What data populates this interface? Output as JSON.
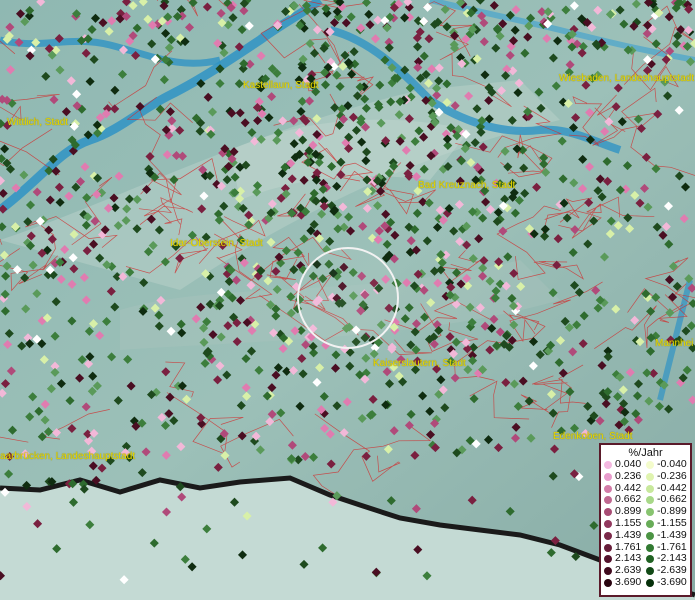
{
  "map": {
    "places": [
      {
        "id": "kastellaun",
        "label": "Kastellaun, Stadt"
      },
      {
        "id": "wiesbaden",
        "label": "Wiesbaden, Landeshauptstadt"
      },
      {
        "id": "wittlich",
        "label": "Wittlich, Stadt"
      },
      {
        "id": "bad-kreuznach",
        "label": "Bad Kreuznach, Stadt"
      },
      {
        "id": "idar-oberstein",
        "label": "Idar-Oberstein, Stadt"
      },
      {
        "id": "kaiserslautern",
        "label": "Kaiserslautern, Stadt"
      },
      {
        "id": "mannheim",
        "label": "Mannhei"
      },
      {
        "id": "edenkoben",
        "label": "Edenkoben, Stadt"
      },
      {
        "id": "saarbruecken",
        "label": "aarbrücken, Landeshauptstadt"
      }
    ]
  },
  "legend": {
    "title": "%/Jahr",
    "positive": [
      "0.040",
      "0.236",
      "0.442",
      "0.662",
      "0.899",
      "1.155",
      "1.439",
      "1.761",
      "2.143",
      "2.639",
      "3.690"
    ],
    "negative": [
      "-0.040",
      "-0.236",
      "-0.442",
      "-0.662",
      "-0.899",
      "-1.155",
      "-1.439",
      "-1.761",
      "-2.143",
      "-2.639",
      "-3.690"
    ],
    "positive_colors": [
      "#f4b8e0",
      "#e89ccc",
      "#d47ca8",
      "#c06890",
      "#a84c74",
      "#92385e",
      "#7c2a4a",
      "#681e3a",
      "#54122c",
      "#400a1e",
      "#2a0410"
    ],
    "negative_colors": [
      "#f4fccc",
      "#e0f4b0",
      "#c8e89c",
      "#a8d888",
      "#88c470",
      "#68ac58",
      "#4c9444",
      "#327a32",
      "#206222",
      "#124a16",
      "#06300a"
    ]
  }
}
